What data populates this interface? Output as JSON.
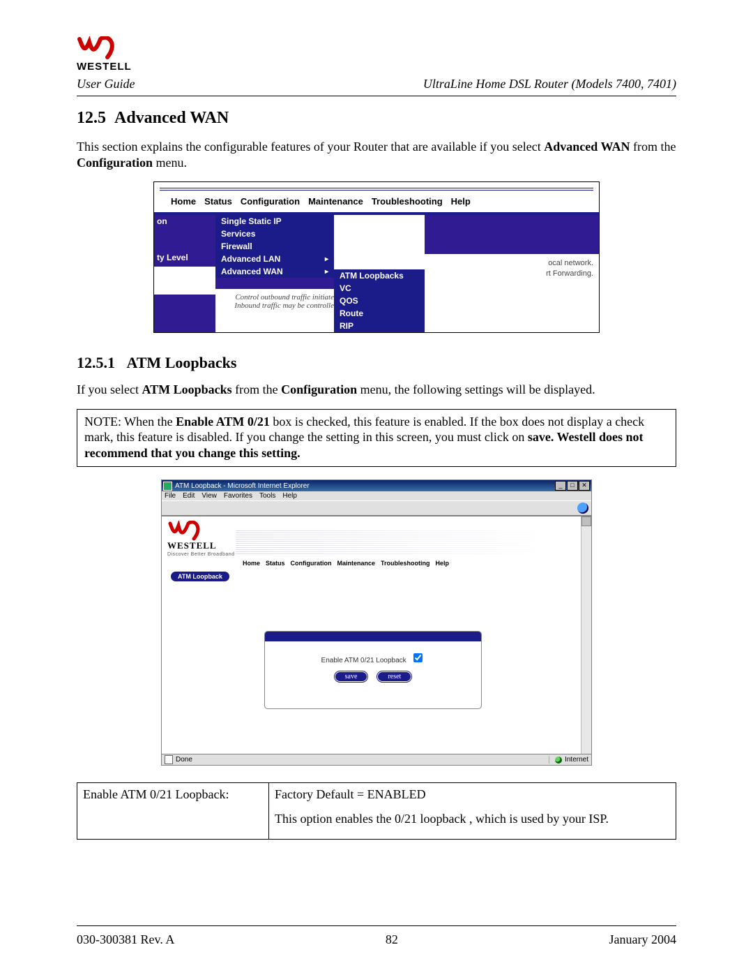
{
  "header": {
    "brand": "WESTELL",
    "left": "User Guide",
    "right": "UltraLine Home DSL Router (Models 7400, 7401)"
  },
  "section": {
    "number": "12.5",
    "title": "Advanced WAN",
    "intro_plain_a": "This section explains the configurable features of your Router that are available if you select ",
    "intro_bold_a": "Advanced WAN",
    "intro_plain_b": " from the ",
    "intro_bold_b": "Configuration",
    "intro_plain_c": " menu."
  },
  "screenshot1": {
    "nav": [
      "Home",
      "Status",
      "Configuration",
      "Maintenance",
      "Troubleshooting",
      "Help"
    ],
    "left_tag_top": "on",
    "left_tag_bottom": "ty Level",
    "config_menu": [
      "Single Static IP",
      "Services",
      "Firewall",
      "Advanced LAN",
      "Advanced WAN"
    ],
    "adv_wan_submenu": [
      "ATM Loopbacks",
      "VC",
      "QOS",
      "Route",
      "RIP"
    ],
    "bg_line1_left": "Control outbound traffic initiate",
    "bg_line1_right": "ocal network.",
    "bg_line2_left": "Inbound traffic may be controlle",
    "bg_line2_right": "rt Forwarding."
  },
  "subsection": {
    "number": "12.5.1",
    "title": "ATM Loopbacks",
    "intro_a": "If you select ",
    "intro_bold_a": "ATM Loopbacks",
    "intro_b": " from the ",
    "intro_bold_b": "Configuration",
    "intro_c": " menu, the following settings will be displayed."
  },
  "note": {
    "a": "NOTE: When the ",
    "b_bold": "Enable ATM 0/21",
    "c": " box is checked, this feature is enabled. If the box does not display a check mark, this feature is disabled.  If you change the setting in this screen, you must click on ",
    "d_bold": "save. Westell does not recommend that you change this setting."
  },
  "screenshot2": {
    "window_title": "ATM Loopback - Microsoft Internet Explorer",
    "menus": [
      "File",
      "Edit",
      "View",
      "Favorites",
      "Tools",
      "Help"
    ],
    "brand": "WESTELL",
    "tagline": "Discover Better Broadband",
    "nav": [
      "Home",
      "Status",
      "Configuration",
      "Maintenance",
      "Troubleshooting",
      "Help"
    ],
    "side_label": "ATM Loopback",
    "form_label": "Enable ATM 0/21 Loopback",
    "save": "save",
    "reset": "reset",
    "status_left": "Done",
    "status_right": "Internet"
  },
  "table": {
    "row1_left": "Enable ATM 0/21 Loopback:",
    "row1_right_line1": "Factory Default = ENABLED",
    "row1_right_line2": "This option enables the 0/21 loopback , which is used by your ISP."
  },
  "footer": {
    "left": "030-300381 Rev. A",
    "center": "82",
    "right": "January 2004"
  }
}
